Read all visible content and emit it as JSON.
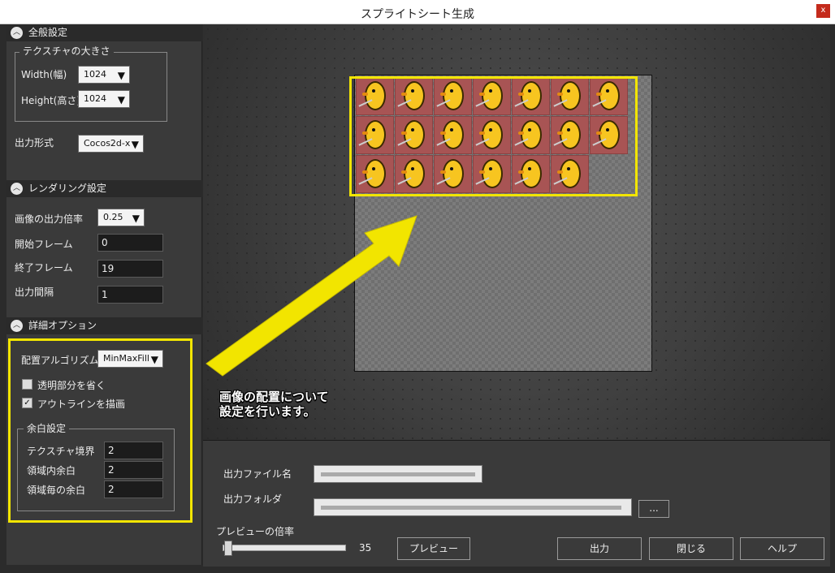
{
  "window": {
    "title": "スプライトシート生成",
    "close_label": "x"
  },
  "general": {
    "header": "全般設定",
    "texture_group": "テクスチャの大きさ",
    "width_label": "Width(幅)",
    "width_value": "1024",
    "height_label": "Height(高さ)",
    "height_value": "1024",
    "format_label": "出力形式",
    "format_value": "Cocos2d-x"
  },
  "rendering": {
    "header": "レンダリング設定",
    "scale_label": "画像の出力倍率",
    "scale_value": "0.25",
    "start_label": "開始フレーム",
    "start_value": "0",
    "end_label": "終了フレーム",
    "end_value": "19",
    "interval_label": "出力間隔",
    "interval_value": "1"
  },
  "details": {
    "header": "詳細オプション",
    "algo_label": "配置アルゴリズム",
    "algo_value": "MinMaxFill",
    "transparent_label": "透明部分を省く",
    "transparent_checked": false,
    "outline_label": "アウトラインを描画",
    "outline_checked": true,
    "margin_group": "余白設定",
    "border_label": "テクスチャ境界",
    "border_value": "2",
    "inner_label": "領域内余白",
    "inner_value": "2",
    "each_label": "領域毎の余白",
    "each_value": "2"
  },
  "preview": {
    "annotation_line1": "画像の配置について",
    "annotation_line2": "設定を行います。",
    "sprite_count": 20,
    "sprite_columns": 7
  },
  "output": {
    "file_label": "出力ファイル名",
    "folder_label": "出力フォルダ",
    "browse_label": "...",
    "zoom_label": "プレビューの倍率",
    "zoom_value": "35",
    "preview_button": "プレビュー",
    "export_button": "出力",
    "close_button": "閉じる",
    "help_button": "ヘルプ"
  },
  "colors": {
    "highlight": "#f2e500",
    "sprite_bg": "#a85454"
  }
}
